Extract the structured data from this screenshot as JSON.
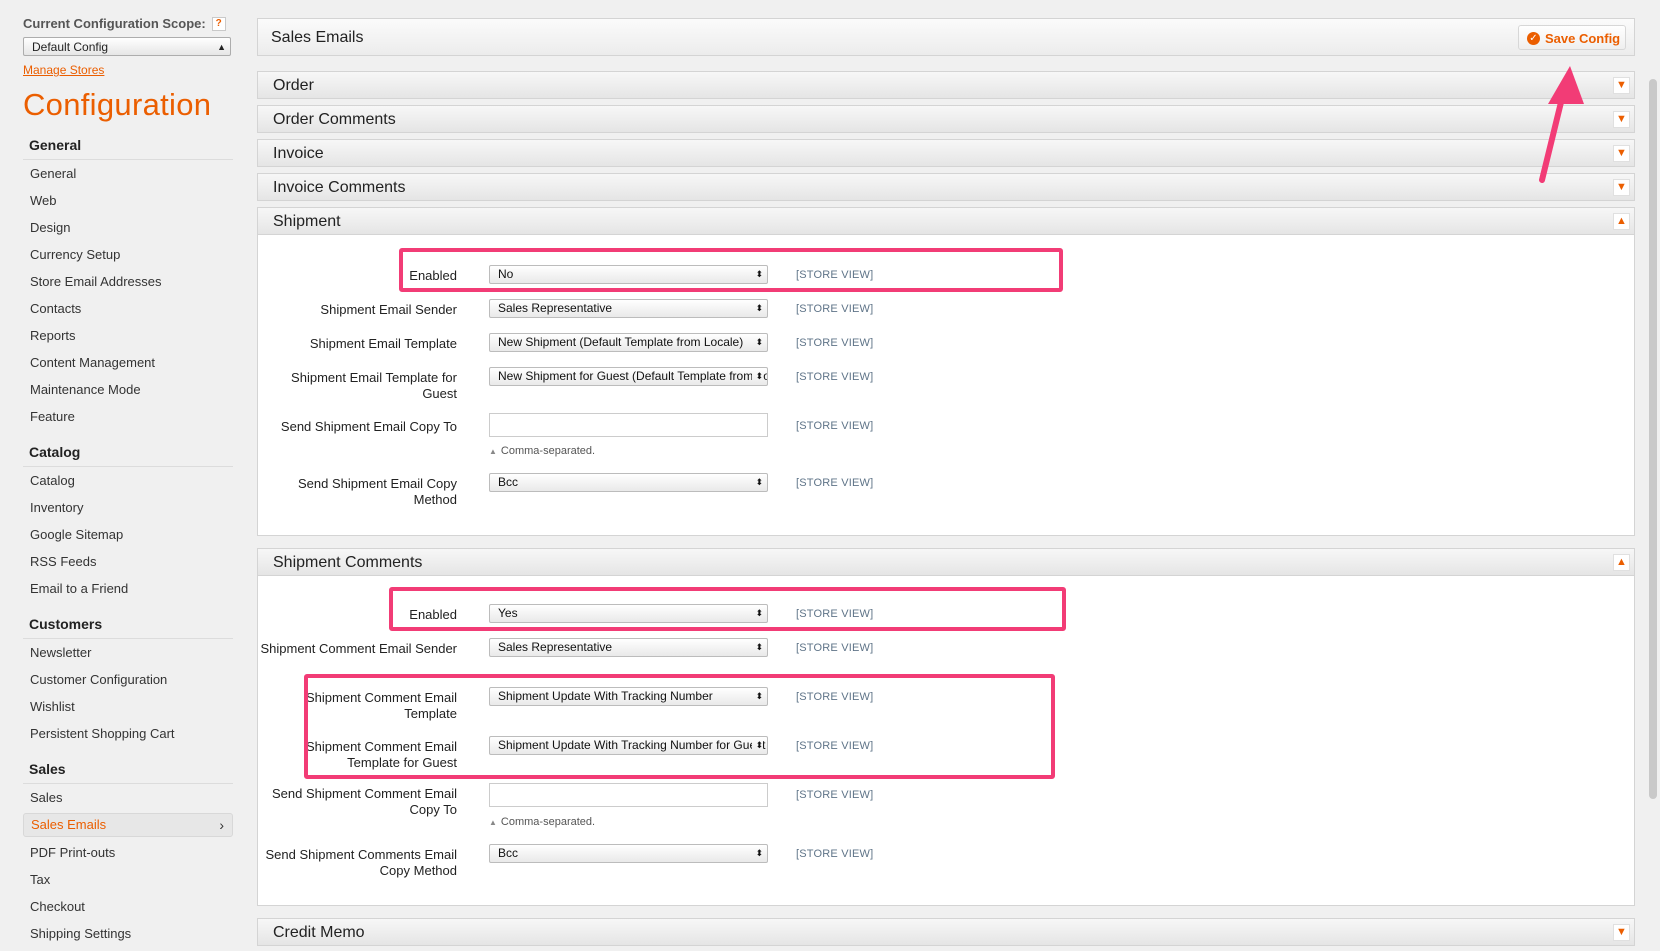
{
  "sidebar": {
    "scope_label": "Current Configuration Scope:",
    "scope_help": "?",
    "scope_value": "Default Config",
    "manage_stores": "Manage Stores",
    "title": "Configuration",
    "groups": [
      {
        "title": "General",
        "items": [
          "General",
          "Web",
          "Design",
          "Currency Setup",
          "Store Email Addresses",
          "Contacts",
          "Reports",
          "Content Management",
          "Maintenance Mode",
          "Feature"
        ]
      },
      {
        "title": "Catalog",
        "items": [
          "Catalog",
          "Inventory",
          "Google Sitemap",
          "RSS Feeds",
          "Email to a Friend"
        ]
      },
      {
        "title": "Customers",
        "items": [
          "Newsletter",
          "Customer Configuration",
          "Wishlist",
          "Persistent Shopping Cart"
        ]
      },
      {
        "title": "Sales",
        "items": [
          "Sales",
          "Sales Emails",
          "PDF Print-outs",
          "Tax",
          "Checkout",
          "Shipping Settings"
        ]
      }
    ],
    "active_item": "Sales Emails"
  },
  "header": {
    "title": "Sales Emails",
    "save_label": "Save Config"
  },
  "sections": {
    "order": "Order",
    "order_comments": "Order Comments",
    "invoice": "Invoice",
    "invoice_comments": "Invoice Comments",
    "shipment": "Shipment",
    "shipment_comments": "Shipment Comments",
    "credit_memo": "Credit Memo"
  },
  "scope_tag": "[STORE VIEW]",
  "comma_note": "Comma-separated.",
  "shipment": {
    "enabled_label": "Enabled",
    "enabled_value": "No",
    "sender_label": "Shipment Email Sender",
    "sender_value": "Sales Representative",
    "template_label": "Shipment Email Template",
    "template_value": "New Shipment (Default Template from Locale)",
    "guest_template_label": "Shipment Email Template for Guest",
    "guest_template_value": "New Shipment for Guest (Default Template from Locale)",
    "copy_to_label": "Send Shipment Email Copy To",
    "copy_to_value": "",
    "copy_method_label": "Send Shipment Email Copy Method",
    "copy_method_value": "Bcc"
  },
  "shipment_comments": {
    "enabled_label": "Enabled",
    "enabled_value": "Yes",
    "sender_label": "Shipment Comment Email Sender",
    "sender_value": "Sales Representative",
    "template_label": "Shipment Comment Email Template",
    "template_value": "Shipment Update With Tracking Number",
    "guest_template_label": "Shipment Comment Email Template for Guest",
    "guest_template_value": "Shipment Update With Tracking Number for Guest",
    "copy_to_label": "Send Shipment Comment Email Copy To",
    "copy_to_value": "",
    "copy_method_label": "Send Shipment Comments Email Copy Method",
    "copy_method_value": "Bcc"
  },
  "colors": {
    "accent": "#eb5e00",
    "highlight": "#f23c76",
    "scope_tag": "#5f7488"
  }
}
